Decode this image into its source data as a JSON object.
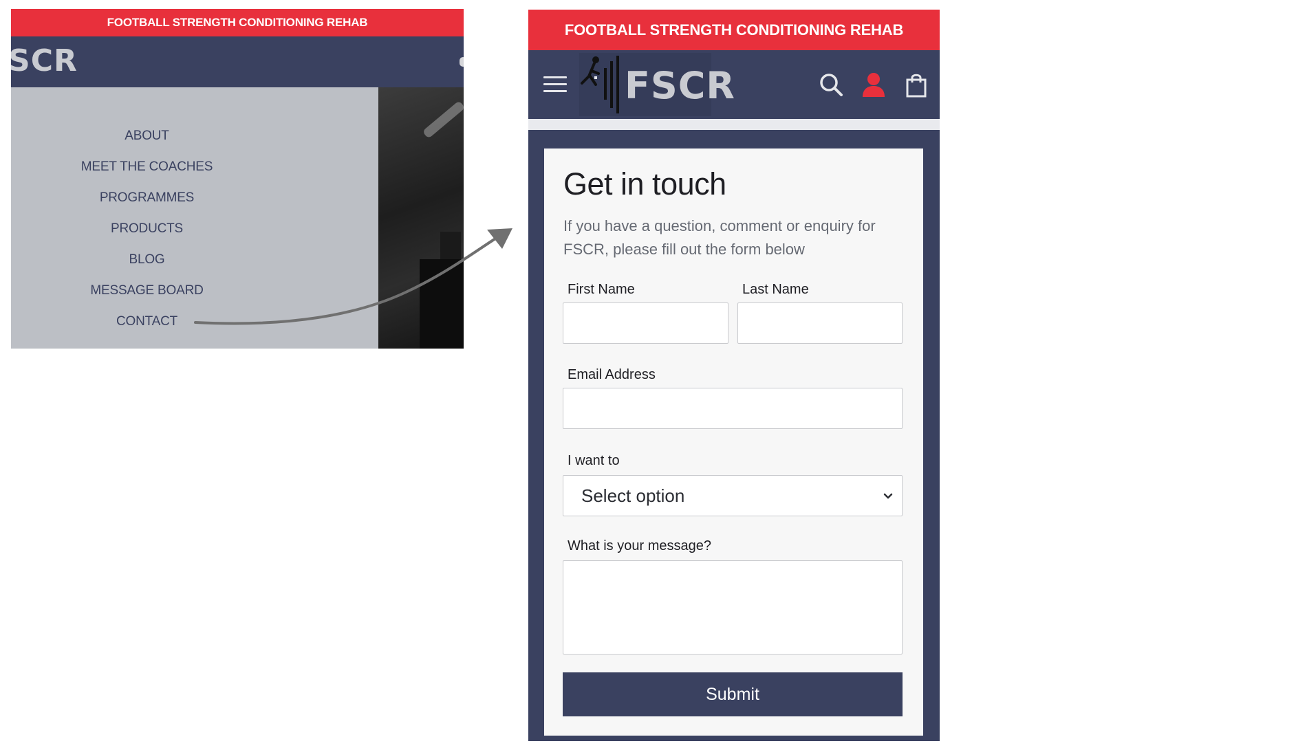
{
  "menu_screen": {
    "banner": "FOOTBALL STRENGTH CONDITIONING REHAB",
    "logo_text": "SCR",
    "items": [
      "ABOUT",
      "MEET THE COACHES",
      "PROGRAMMES",
      "PRODUCTS",
      "BLOG",
      "MESSAGE BOARD",
      "CONTACT"
    ]
  },
  "contact_screen": {
    "banner": "FOOTBALL STRENGTH CONDITIONING REHAB",
    "logo_text": "FSCR",
    "icons": {
      "menu": "hamburger-icon",
      "search": "search-icon",
      "account": "user-icon",
      "cart": "shopping-bag-icon"
    },
    "form": {
      "title": "Get in touch",
      "intro": "If you have a question, comment or enquiry for FSCR, please fill out the form below",
      "first_name_label": "First Name",
      "first_name_value": "",
      "last_name_label": "Last Name",
      "last_name_value": "",
      "email_label": "Email Address",
      "email_value": "",
      "want_label": "I want to",
      "want_selected": "Select option",
      "message_label": "What is your message?",
      "message_value": "",
      "submit_label": "Submit"
    }
  },
  "colors": {
    "banner_red": "#e8303c",
    "navy": "#3a4160",
    "menu_grey": "#bcbfc5",
    "account_red": "#e8303c"
  }
}
